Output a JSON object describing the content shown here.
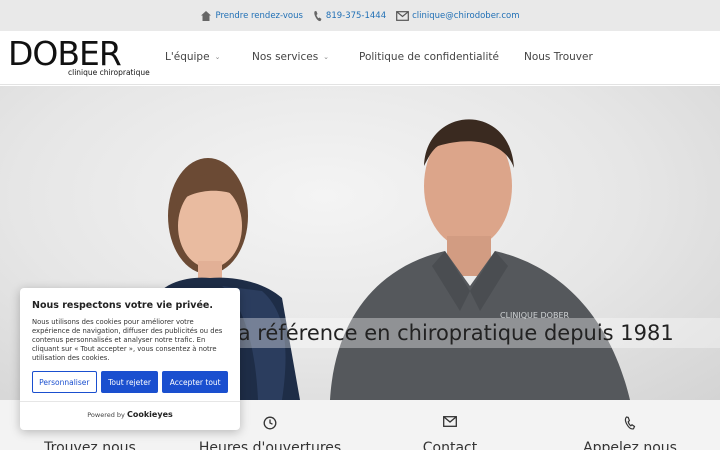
{
  "topbar": {
    "appointment": "Prendre rendez-vous",
    "phone": "819-375-1444",
    "email": "clinique@chirodober.com"
  },
  "logo": {
    "wordmark": "DOBER",
    "subtitle": "clinique chiropratique"
  },
  "nav": {
    "items": [
      {
        "label": "L'équipe",
        "caret": "⌄"
      },
      {
        "label": "Nos services",
        "caret": "⌄"
      },
      {
        "label": "Politique de confidentialité"
      },
      {
        "label": "Nous Trouver"
      }
    ]
  },
  "hero": {
    "tagline": "La référence en chiropratique depuis 1981",
    "shirt_logo": "CLINIQUE DOBER"
  },
  "info": {
    "columns": [
      {
        "label": "Trouvez nous",
        "icon": "location-icon"
      },
      {
        "label": "Heures d'ouvertures",
        "icon": "clock-icon"
      },
      {
        "label": "Contact",
        "icon": "envelope-icon"
      },
      {
        "label": "Appelez nous",
        "icon": "phone-icon"
      }
    ]
  },
  "cookie": {
    "title": "Nous respectons votre vie privée.",
    "text": "Nous utilisons des cookies pour améliorer votre expérience de navigation, diffuser des publicités ou des contenus personnalisés et analyser notre trafic. En cliquant sur « Tout accepter », vous consentez à notre utilisation des cookies.",
    "customize": "Personnaliser",
    "reject": "Tout rejeter",
    "accept": "Accepter tout",
    "powered_by": "Powered by",
    "brand": "Cookieyes"
  },
  "colors": {
    "link_blue": "#1f6fb5",
    "button_blue": "#1a4fcf",
    "topbar_bg": "#e9e9e9"
  }
}
